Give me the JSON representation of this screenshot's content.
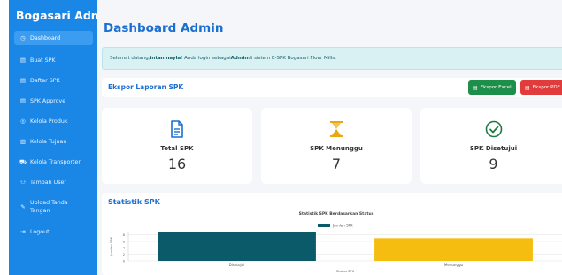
{
  "sidebar": {
    "brand": "Bogasari Admin",
    "items": [
      {
        "label": "Dashboard",
        "icon": "gauge-icon",
        "glyph": "◷"
      },
      {
        "label": "Buat SPK",
        "icon": "file-plus-icon",
        "glyph": "▤"
      },
      {
        "label": "Daftar SPK",
        "icon": "list-icon",
        "glyph": "▤"
      },
      {
        "label": "SPK Approve",
        "icon": "check-file-icon",
        "glyph": "▤"
      },
      {
        "label": "Kelola Produk",
        "icon": "box-icon",
        "glyph": "◎"
      },
      {
        "label": "Kelola Tujuan",
        "icon": "building-icon",
        "glyph": "▥"
      },
      {
        "label": "Kelola Transporter",
        "icon": "truck-icon",
        "glyph": "⛟"
      },
      {
        "label": "Tambah User",
        "icon": "user-plus-icon",
        "glyph": "⚇"
      },
      {
        "label": "Upload Tanda Tangan",
        "icon": "pen-icon",
        "glyph": "✎"
      },
      {
        "label": "Logout",
        "icon": "logout-icon",
        "glyph": "⇥"
      }
    ]
  },
  "header": {
    "title": "Dashboard Admin"
  },
  "alert": {
    "prefix": "Selamat datang, ",
    "user": "intan nayla",
    "middle": "! Anda login sebagai ",
    "role": "Admin",
    "suffix": " di sistem E-SPK Bogasari Flour Mills."
  },
  "export": {
    "title": "Ekspor Laporan SPK",
    "excel_label": "Ekspor Excel",
    "pdf_label": "Ekspor PDF"
  },
  "stats": [
    {
      "label": "Total SPK",
      "value": "16",
      "icon": "document-icon",
      "color": "#1a6fd1"
    },
    {
      "label": "SPK Menunggu",
      "value": "7",
      "icon": "hourglass-icon",
      "color": "#e8a912"
    },
    {
      "label": "SPK Disetujui",
      "value": "9",
      "icon": "check-circle-icon",
      "color": "#1e7a44"
    }
  ],
  "colors": {
    "sidebar": "#1a86e6",
    "accent": "#1a6fd1",
    "excel": "#1e8f4a",
    "pdf": "#e23b3b"
  },
  "chart_section": {
    "heading": "Statistik SPK"
  },
  "chart_data": {
    "type": "bar",
    "title": "Statistik SPK Berdasarkan Status",
    "categories": [
      "Disetujui",
      "Menunggu"
    ],
    "series": [
      {
        "name": "Jumlah SPK",
        "values": [
          9,
          7
        ]
      }
    ],
    "colors": [
      "#0b5a6a",
      "#f5bd10"
    ],
    "xlabel": "Status SPK",
    "ylabel": "Jumlah SPK",
    "yticks": [
      0,
      2,
      4,
      6,
      8
    ],
    "ylim": [
      0,
      9
    ],
    "grid": true,
    "legend": "top"
  }
}
